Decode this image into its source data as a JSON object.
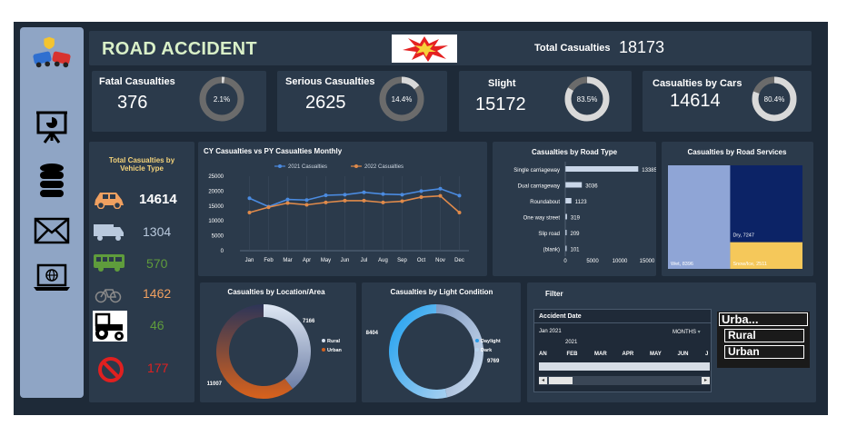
{
  "header": {
    "title": "ROAD ACCIDENT",
    "total_label": "Total Casualties",
    "total_value": "18173"
  },
  "kpis": [
    {
      "label": "Fatal Casualties",
      "value": "376",
      "pct": "2.1%",
      "fraction": 0.021
    },
    {
      "label": "Serious Casualties",
      "value": "2625",
      "pct": "14.4%",
      "fraction": 0.144
    },
    {
      "label": "Slight",
      "value": "15172",
      "pct": "83.5%",
      "fraction": 0.835
    },
    {
      "label": "Casualties by Cars",
      "value": "14614",
      "pct": "80.4%",
      "fraction": 0.804
    }
  ],
  "vehicle": {
    "title_line1": "Total Casualties by",
    "title_line2": "Vehicle Type",
    "items": [
      {
        "icon": "car-icon",
        "value": "14614",
        "color": "#ffffff"
      },
      {
        "icon": "van-icon",
        "value": "1304",
        "color": "#b9c9dd"
      },
      {
        "icon": "bus-icon",
        "value": "570",
        "color": "#5f9c3c"
      },
      {
        "icon": "bicycle-icon",
        "value": "1462",
        "color": "#f0a060"
      },
      {
        "icon": "tractor-icon",
        "value": "46",
        "color": "#5f9c3c"
      },
      {
        "icon": "no-entry-icon",
        "value": "177",
        "color": "#e02020"
      }
    ]
  },
  "filter": {
    "title": "Filter",
    "accident_date": "Accident Date",
    "period": "Jan 2021",
    "granularity": "MONTHS",
    "year": "2021",
    "months": [
      "AN",
      "FEB",
      "MAR",
      "APR",
      "MAY",
      "JUN",
      "J"
    ],
    "slicer": [
      "Urba...",
      "Rural",
      "Urban"
    ]
  },
  "chart_data": [
    {
      "type": "line",
      "title": "CY Casualties vs PY Casualties Monthly",
      "categories": [
        "Jan",
        "Feb",
        "Mar",
        "Apr",
        "May",
        "Jun",
        "Jul",
        "Aug",
        "Sep",
        "Oct",
        "Nov",
        "Dec"
      ],
      "series": [
        {
          "name": "2021 Casualties",
          "color": "#4b8be0",
          "values": [
            17600,
            14800,
            17200,
            17000,
            18600,
            18800,
            19600,
            19000,
            18800,
            20000,
            20800,
            18500
          ]
        },
        {
          "name": "2022 Casualties",
          "color": "#e08a4a",
          "values": [
            12800,
            14600,
            16000,
            15400,
            16200,
            16800,
            16800,
            16200,
            16600,
            18000,
            18400,
            12800
          ]
        }
      ],
      "yticks": [
        "25000",
        "20000",
        "15000",
        "10000",
        "5000",
        "0"
      ],
      "ylim": [
        0,
        25000
      ],
      "legend": "top"
    },
    {
      "type": "bar",
      "orientation": "horizontal",
      "title": "Casualties by Road Type",
      "categories": [
        "Single carriageway",
        "Dual carriageway",
        "Roundabout",
        "One way street",
        "Slip road",
        "(blank)"
      ],
      "values": [
        13385,
        3036,
        1123,
        319,
        209,
        101
      ],
      "value_labels": [
        "13385",
        "3036",
        "1123",
        "319",
        "209",
        "101"
      ],
      "xticks": [
        "0",
        "5000",
        "10000",
        "15000"
      ],
      "xlim": [
        0,
        15000
      ]
    },
    {
      "type": "treemap",
      "title": "Casualties by Road Services",
      "items": [
        {
          "label": "Wet, 8396",
          "value": 8396,
          "color": "#8fa5d6"
        },
        {
          "label": "Dry, 7247",
          "value": 7247,
          "color": "#0c2366"
        },
        {
          "label": "Snow/Ice, 2511",
          "value": 2511,
          "color": "#f5c85a"
        }
      ]
    },
    {
      "type": "pie",
      "title": "Casualties by Location/Area",
      "donut": true,
      "items": [
        {
          "name": "Rural",
          "value": 7166,
          "label": "7166",
          "color": "#d8e2f0"
        },
        {
          "name": "Urban",
          "value": 11007,
          "label": "11007",
          "color": "#d0601e"
        }
      ],
      "legend": "right"
    },
    {
      "type": "pie",
      "title": "Casualties by Light Condition",
      "donut": true,
      "items": [
        {
          "name": "Daylight",
          "value": 8404,
          "label": "8404",
          "color": "#2a9ce8"
        },
        {
          "name": "Dark",
          "value": 9769,
          "label": "9769",
          "color": "#b8d4ee"
        }
      ],
      "legend": "right"
    }
  ]
}
